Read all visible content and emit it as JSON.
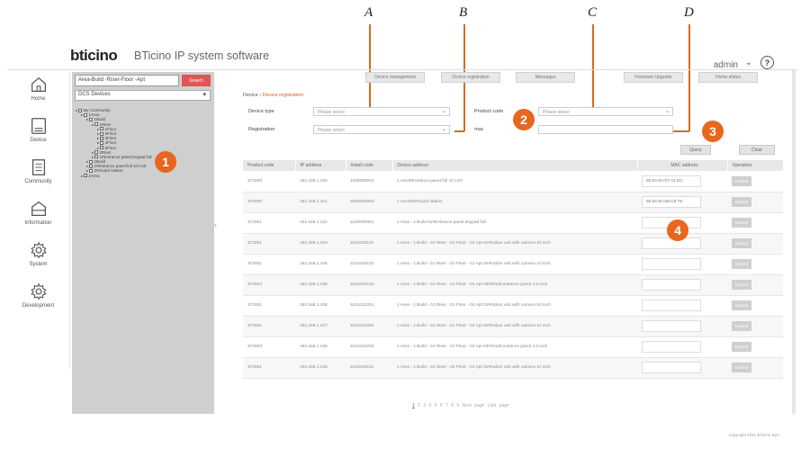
{
  "callouts": {
    "letters": [
      "A",
      "B",
      "C",
      "D"
    ],
    "markers": [
      "1",
      "2",
      "3",
      "4"
    ]
  },
  "app": {
    "brand": "bticino",
    "title": "BTicino IP system software",
    "user": "admin",
    "help": "?"
  },
  "nav": [
    {
      "label": "Home",
      "icon": "home-icon"
    },
    {
      "label": "Device",
      "icon": "device-icon"
    },
    {
      "label": "Community",
      "icon": "community-icon"
    },
    {
      "label": "Information",
      "icon": "information-icon"
    },
    {
      "label": "System",
      "icon": "gear-icon"
    },
    {
      "label": "Development",
      "icon": "gear-icon"
    }
  ],
  "tree": {
    "search_value": "Area-Build -Riser-Floor -Apt",
    "search_button": "Search",
    "select_value": "DCS Devices",
    "nodes": [
      {
        "label": "My Community",
        "indent": 0
      },
      {
        "label": "1Area",
        "indent": 1
      },
      {
        "label": "1Build",
        "indent": 2
      },
      {
        "label": "1Riser",
        "indent": 3
      },
      {
        "label": "1Floor",
        "indent": 4
      },
      {
        "label": "2Floor",
        "indent": 4
      },
      {
        "label": "3Floor",
        "indent": 4
      },
      {
        "label": "4Floor",
        "indent": 4
      },
      {
        "label": "5Floor",
        "indent": 4
      },
      {
        "label": "2Riser",
        "indent": 3
      },
      {
        "label": "1#Entrance panel keypad full",
        "indent": 3
      },
      {
        "label": "2Build",
        "indent": 2
      },
      {
        "label": "1#Entrance panel full 10 inch",
        "indent": 2
      },
      {
        "label": "2#Guard station",
        "indent": 2
      },
      {
        "label": "2Area",
        "indent": 1
      }
    ]
  },
  "toolbar": [
    "Device management",
    "Device registration",
    "Messages",
    "Firmware Upgrade",
    "Home status"
  ],
  "breadcrumb": {
    "root": "Device",
    "current": "Device registration"
  },
  "filters": {
    "device_type_label": "Device type",
    "device_type_value": "Please select",
    "product_code_label": "Product code",
    "product_code_value": "Please select",
    "registration_label": "Registration",
    "registration_value": "Please select",
    "mac_label": "mac",
    "mac_value": "",
    "query_button": "Query",
    "clear_button": "Clear"
  },
  "table": {
    "columns": [
      "Product code",
      "IP address",
      "Install code",
      "Device address",
      "MAC address",
      "Operation"
    ],
    "rows": [
      {
        "code": "374000",
        "ip": "192.168.1.100",
        "install": "1000000001",
        "address": "1 Area#Entrance panel full 10 inch",
        "mac": "80:02:8A:07:41:DC",
        "op": "Unbind"
      },
      {
        "code": "375000",
        "ip": "192.168.1.101",
        "install": "1000000002",
        "address": "1 Area#2#Guard station",
        "mac": "80:02:8A:06:C6:78",
        "op": "Unbind"
      },
      {
        "code": "374001",
        "ip": "192.168.1.102",
        "install": "1100000001",
        "address": "1 Area - 1 Build 01#Entrance panel keypad full",
        "mac": "",
        "op": "Unbind"
      },
      {
        "code": "373001",
        "ip": "192.168.1.103",
        "install": "1101010101",
        "address": "1 Area - 1 Build - 01 Riser - 01 Floor - 01 Apt 01#Indoor unit with camera 10 inch",
        "mac": "",
        "op": "Unbind"
      },
      {
        "code": "373001",
        "ip": "192.168.1.104",
        "install": "1101010102",
        "address": "1 Area - 1 Build - 01 Riser - 01 Floor - 01 Apt 02#Indoor unit with camera 10 inch",
        "mac": "",
        "op": "Unbind"
      },
      {
        "code": "374003",
        "ip": "192.168.1.105",
        "install": "1101010103",
        "address": "1 Area - 1 Build - 01 Riser - 01 Floor - 01 Apt 03#Small entrance panel 4.3 inch",
        "mac": "",
        "op": "Unbind"
      },
      {
        "code": "373001",
        "ip": "192.168.1.106",
        "install": "1101010201",
        "address": "1 Area - 1 Build - 01 Riser - 01 Floor - 02 Apt 01#Indoor unit with camera 10 inch",
        "mac": "",
        "op": "Unbind"
      },
      {
        "code": "373001",
        "ip": "192.168.1.107",
        "install": "1101010202",
        "address": "1 Area - 1 Build - 01 Riser - 01 Floor - 02 Apt 02#Indoor unit with camera 10 inch",
        "mac": "",
        "op": "Unbind"
      },
      {
        "code": "374003",
        "ip": "192.168.1.108",
        "install": "1101010203",
        "address": "1 Area - 1 Build - 01 Riser - 01 Floor - 02 Apt 03#Small entrance panel 4.3 inch",
        "mac": "",
        "op": "Unbind"
      },
      {
        "code": "373001",
        "ip": "192.168.1.109",
        "install": "1101020101",
        "address": "1 Area - 1 Build - 01 Riser - 02 Floor - 01 Apt 01#Indoor unit with camera 10 inch",
        "mac": "",
        "op": "Unbind"
      }
    ]
  },
  "pager": {
    "pages": [
      "1",
      "2",
      "3",
      "4",
      "5",
      "6",
      "7",
      "8",
      "9"
    ],
    "next": "Next page",
    "last": "Last page"
  },
  "footer": "Copyright 2021 BTicino SpA"
}
